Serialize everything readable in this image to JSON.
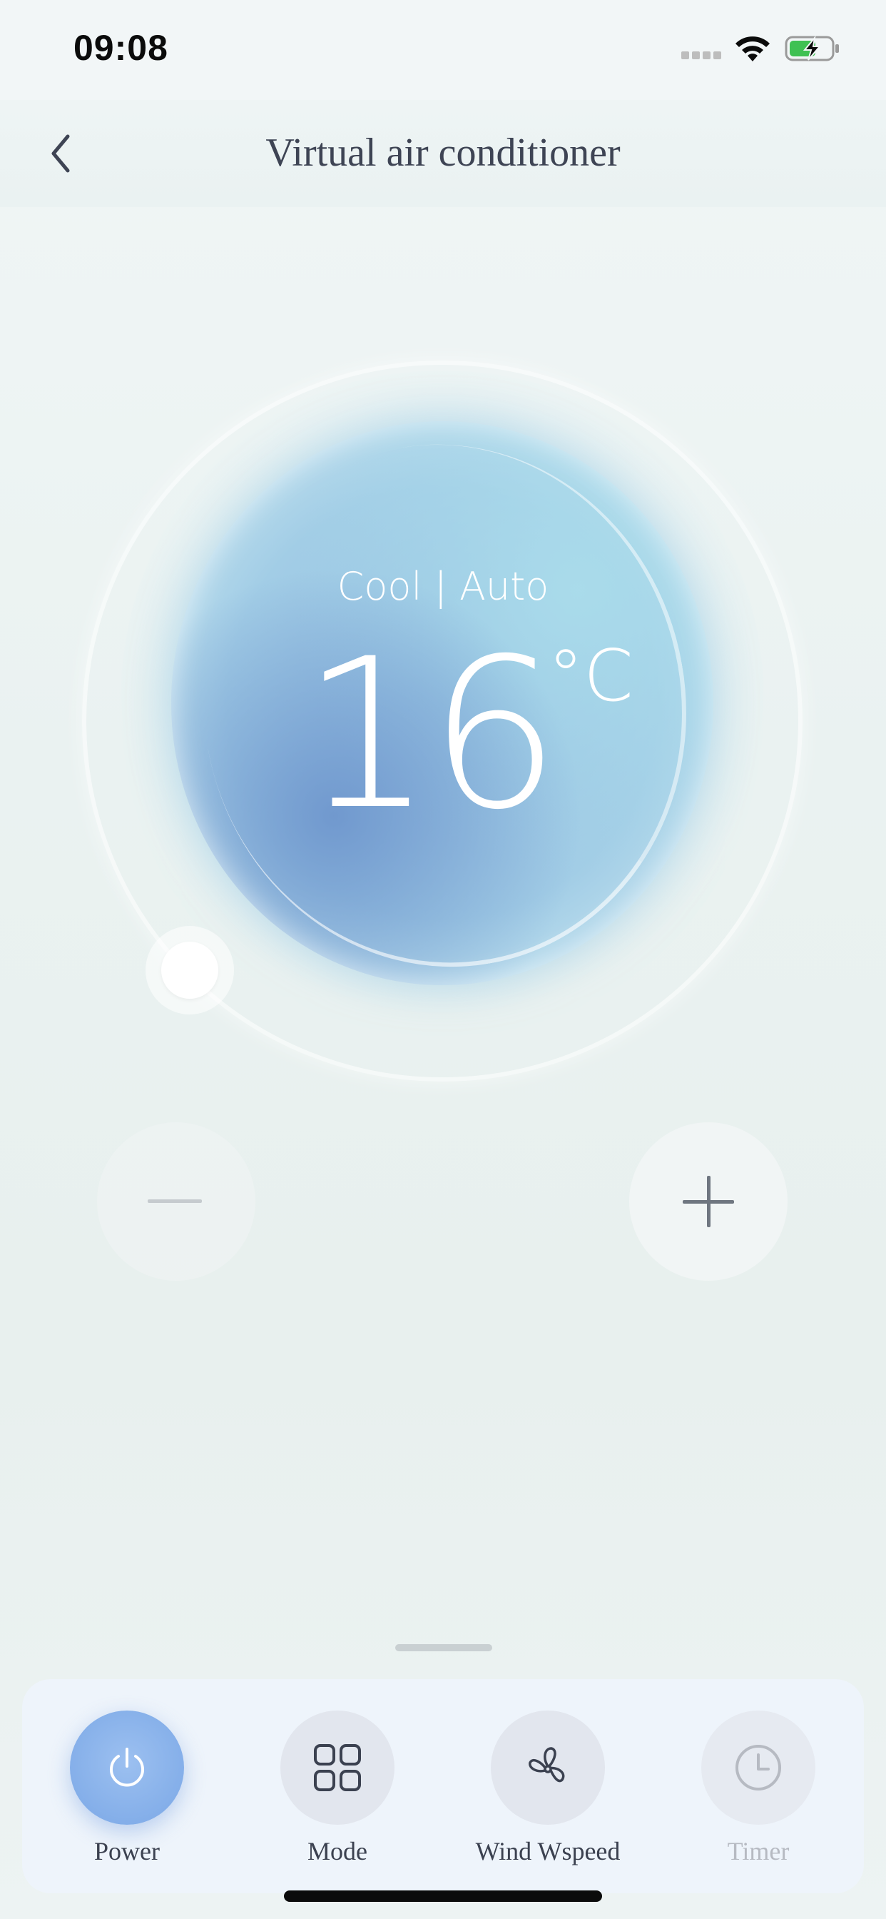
{
  "status_bar": {
    "time": "09:08",
    "wifi_icon": "wifi-icon",
    "battery_icon": "battery-charging-icon",
    "battery_color": "#3fc153"
  },
  "nav": {
    "back_icon": "chevron-left-icon",
    "title": "Virtual air conditioner"
  },
  "thermostat": {
    "mode": "Cool | Auto",
    "temperature": "16",
    "unit": "°C"
  },
  "controls": {
    "decrease_icon": "minus-icon",
    "increase_icon": "plus-icon"
  },
  "tabs": [
    {
      "label": "Power",
      "icon": "power-icon",
      "active": true,
      "color": "#7aa7e6"
    },
    {
      "label": "Mode",
      "icon": "grid-icon",
      "active": false
    },
    {
      "label": "Wind Wspeed",
      "icon": "fan-icon",
      "active": false
    },
    {
      "label": "Timer",
      "icon": "clock-icon",
      "active": false,
      "disabled": true
    }
  ]
}
